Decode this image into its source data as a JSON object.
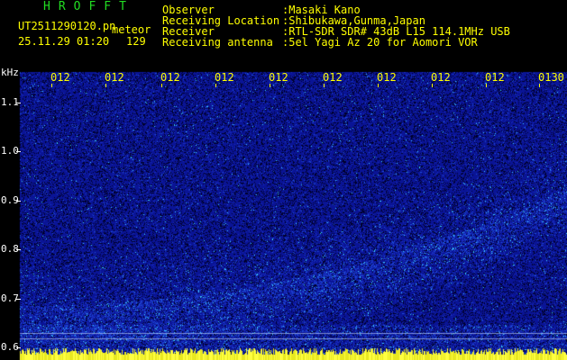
{
  "header": {
    "app_title": "HROFFT",
    "file_name": "UT2511290120.pn",
    "meteor_label": "meteor",
    "timestamp": "25.11.29 01:20",
    "count": "129"
  },
  "info": [
    {
      "label": "Observer",
      "value": ":Masaki Kano"
    },
    {
      "label": "Receiving Location",
      "value": ":Shibukawa,Gunma,Japan"
    },
    {
      "label": "Receiver",
      "value": ":RTL-SDR SDR# 43dB L15 114.1MHz USB"
    },
    {
      "label": "Receiving antenna",
      "value": ":5el Yagi Az 20 for Aomori VOR"
    }
  ],
  "freq_axis": {
    "unit": "kHz",
    "ticks": [
      {
        "value": 1.1,
        "label": "1.1"
      },
      {
        "value": 1.0,
        "label": "1.0"
      },
      {
        "value": 0.9,
        "label": "0.9"
      },
      {
        "value": 0.8,
        "label": "0.8"
      },
      {
        "value": 0.7,
        "label": "0.7"
      },
      {
        "value": 0.6,
        "label": "0.6"
      }
    ],
    "min": 0.575,
    "max": 1.18
  },
  "time_axis": {
    "ticks": [
      "012",
      "012",
      "012",
      "012",
      "012",
      "012",
      "012",
      "012",
      "012",
      "0130"
    ]
  },
  "colors": {
    "background": "#000000",
    "spectrogram_base": "#0a1496",
    "noise_low": "#1e32c8",
    "noise_high": "#3cc8ff",
    "label_yellow": "#ffff00",
    "title_green": "#22dd22",
    "text_white": "#ffffff"
  }
}
